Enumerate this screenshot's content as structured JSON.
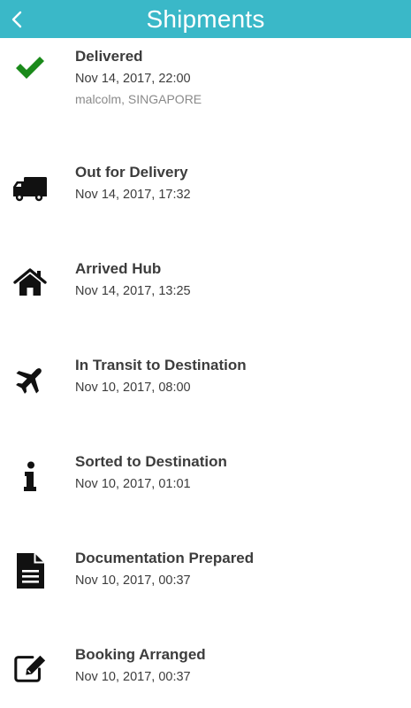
{
  "header": {
    "title": "Shipments",
    "back_icon": "chevron-left-icon",
    "background_color": "#3ab8c8"
  },
  "events": [
    {
      "status": "Delivered",
      "datetime": "Nov 14, 2017, 22:00",
      "location": "malcolm, SINGAPORE",
      "icon": "check-icon",
      "icon_color": "#1a8a1a"
    },
    {
      "status": "Out for Delivery",
      "datetime": "Nov 14, 2017, 17:32",
      "icon": "truck-icon",
      "icon_color": "#111111"
    },
    {
      "status": "Arrived Hub",
      "datetime": "Nov 14, 2017, 13:25",
      "icon": "home-icon",
      "icon_color": "#111111"
    },
    {
      "status": "In Transit to Destination",
      "datetime": "Nov 10, 2017, 08:00",
      "icon": "plane-icon",
      "icon_color": "#111111"
    },
    {
      "status": "Sorted to Destination",
      "datetime": "Nov 10, 2017, 01:01",
      "icon": "info-icon",
      "icon_color": "#111111"
    },
    {
      "status": "Documentation Prepared",
      "datetime": "Nov 10, 2017, 00:37",
      "icon": "document-icon",
      "icon_color": "#111111"
    },
    {
      "status": "Booking Arranged",
      "datetime": "Nov 10, 2017, 00:37",
      "icon": "edit-icon",
      "icon_color": "#111111"
    }
  ]
}
